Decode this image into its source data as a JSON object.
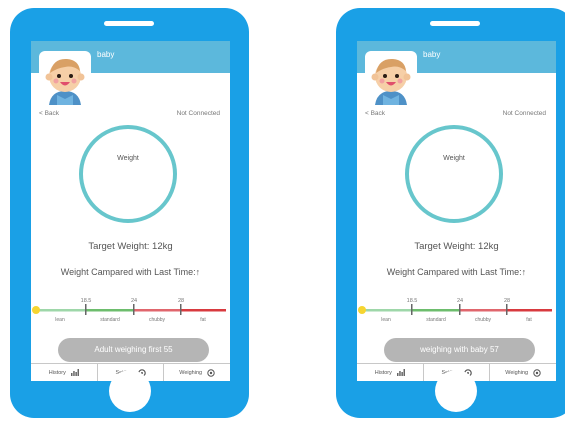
{
  "phones": [
    {
      "header_title": "baby",
      "back_label": "< Back",
      "connection_status": "Not Connected",
      "ring_label": "Weight",
      "target_weight": "Target Weight: 12kg",
      "compared_text": "Weight Campared with Last Time:↑",
      "scale": {
        "ticks": [
          "18.5",
          "24",
          "28"
        ],
        "zones": [
          "lean",
          "standard",
          "chubby",
          "fat"
        ]
      },
      "action_label": "Adult weighing first 55",
      "tabs": [
        {
          "label": "History",
          "icon": "chart-icon"
        },
        {
          "label": "Setting",
          "icon": "gear-icon"
        },
        {
          "label": "Weighing",
          "icon": "scale-icon"
        }
      ]
    },
    {
      "header_title": "baby",
      "back_label": "< Back",
      "connection_status": "Not Connected",
      "ring_label": "Weight",
      "target_weight": "Target Weight: 12kg",
      "compared_text": "Weight Campared with Last Time:↑",
      "scale": {
        "ticks": [
          "18.5",
          "24",
          "28"
        ],
        "zones": [
          "lean",
          "standard",
          "chubby",
          "fat"
        ]
      },
      "action_label": "weighing with baby 57",
      "tabs": [
        {
          "label": "History",
          "icon": "chart-icon"
        },
        {
          "label": "Setting",
          "icon": "gear-icon"
        },
        {
          "label": "Weighing",
          "icon": "scale-icon"
        }
      ]
    }
  ],
  "colors": {
    "phone_body": "#1aa0e6",
    "header": "#5cb8dc",
    "ring": "#67c6cc",
    "scale_lean": "#9ed7a9",
    "scale_standard": "#6dbd6d",
    "scale_chubby": "#e0666d",
    "scale_fat": "#d83a3f",
    "indicator": "#f6d531",
    "button": "#b5b5b5"
  }
}
